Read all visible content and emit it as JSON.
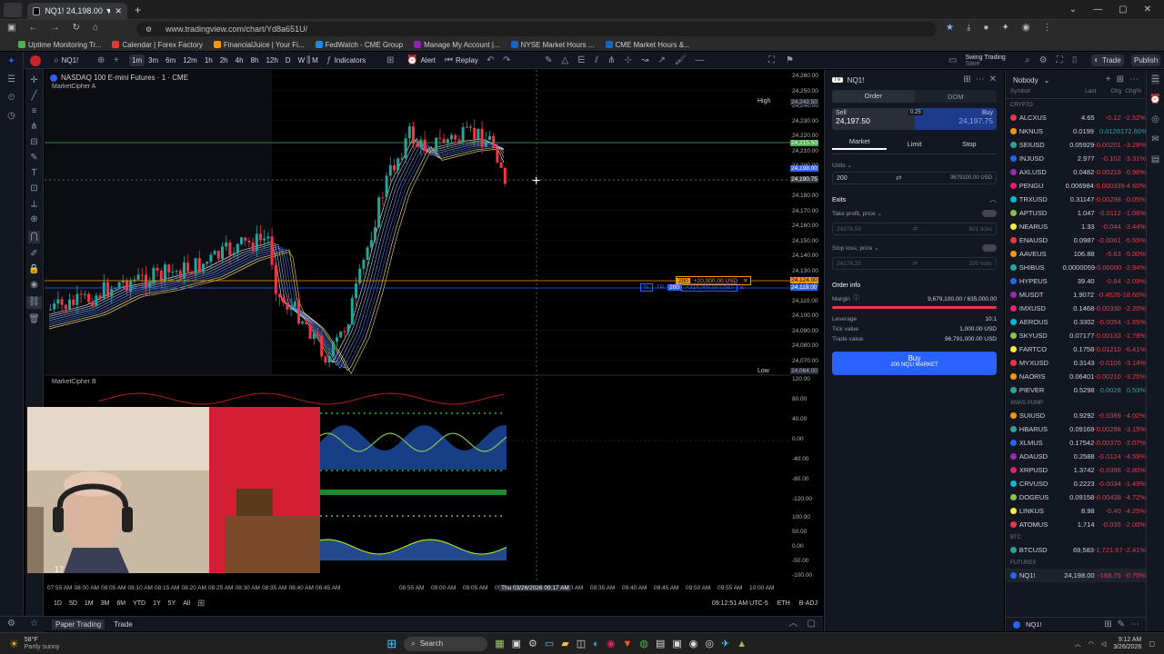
{
  "browser": {
    "tab_title": "NQ1! 24,198.00 ▼ −0.7% Swing",
    "url": "www.tradingview.com/chart/Yd8a651U/",
    "bookmarks": [
      "Uptime Monitoring Tr...",
      "Calendar | Forex Factory",
      "FinancialJuice | Your Fi...",
      "FedWatch - CME Group",
      "Manage My Account |...",
      "NYSE Market Hours ...",
      "CME Market Hours &..."
    ]
  },
  "toolbar": {
    "symbol": "NQ1!",
    "tf_active": "1m",
    "timeframes": [
      "3m",
      "6m",
      "12m",
      "1h",
      "2h",
      "4h",
      "8h",
      "12h",
      "D",
      "W",
      "M"
    ],
    "indicators": "Indicators",
    "alert": "Alert",
    "replay": "Replay",
    "layout_name": "Swing Trading",
    "layout_sub": "Save",
    "trade": "Trade",
    "publish": "Publish"
  },
  "chart": {
    "title": "NASDAQ 100 E-mini Futures · 1 · CME",
    "indicator_a": "MarketCipher A",
    "indicator_b": "MarketCipher B",
    "high_label": "High",
    "high_value": "24,242.50",
    "low_label": "Low",
    "low_value": "24,064.00",
    "price_ticks": [
      "24,260.00",
      "24,250.00",
      "24,240.00",
      "24,230.00",
      "24,220.00",
      "24,210.00",
      "24,200.00",
      "24,190.00",
      "24,180.00",
      "24,170.00",
      "24,160.00",
      "24,150.00",
      "24,140.00",
      "24,130.00",
      "24,120.00",
      "24,110.00",
      "24,100.00",
      "24,090.00",
      "24,080.00",
      "24,070.00"
    ],
    "price_tag_1": "24,215.50",
    "price_tag_2": "24,198.00",
    "price_tag_3": "24,190.75",
    "price_tag_4": "24,124.00",
    "price_tag_5": "24,119.00",
    "sl_qty": "200",
    "sl_text": "+20,000.00 USD",
    "tp_label": "TP",
    "tp_qty": "200",
    "tp_text": "+314,000.00 USD",
    "osc_ticks": [
      "120.00",
      "80.00",
      "40.00",
      "0.00",
      "-40.00",
      "-80.00",
      "-120.00"
    ],
    "osc2_ticks": [
      "100.00",
      "50.00",
      "0.00",
      "-50.00",
      "-100.00"
    ],
    "time_ticks": [
      "07:55 AM",
      "08:00 AM",
      "08:05 AM",
      "08:10 AM",
      "08:15 AM",
      "08:20 AM",
      "08:25 AM",
      "08:30 AM",
      "08:35 AM",
      "08:40 AM",
      "08:45 AM",
      "08:55 AM",
      "09:00 AM",
      "09:05 AM",
      "09:10",
      "09:25 AM",
      "09:30 AM",
      "09:35 AM",
      "09:40 AM",
      "09:45 AM",
      "09:50 AM",
      "09:55 AM",
      "10:00 AM"
    ],
    "crosshair_time": "Thu 03/26/2026",
    "crosshair_time2": "09:17 AM",
    "ranges": [
      "1D",
      "5D",
      "1M",
      "3M",
      "6M",
      "YTD",
      "1Y",
      "5Y",
      "All"
    ],
    "clock": "09:12:51 AM UTC-5",
    "session": "ETH",
    "adj": "B-ADJ"
  },
  "order": {
    "symbol": "NQ1!",
    "tab_order": "Order",
    "tab_dom": "DOM",
    "sell_label": "Sell",
    "sell_price": "24,197.50",
    "spread": "0.25",
    "buy_label": "Buy",
    "buy_price": "24,197.75",
    "types": [
      "Market",
      "Limit",
      "Stop"
    ],
    "units_label": "Units",
    "units_value": "200",
    "units_usd": "9679100.00 USD",
    "exits": "Exits",
    "tp_label": "Take profit, price",
    "tp_price": "24376.50",
    "tp_ticks": "601 ticks",
    "sl_label": "Stop loss, price",
    "sl_price": "24176.25",
    "sl_ticks": "200 ticks",
    "info": "Order info",
    "margin_label": "Margin",
    "margin_value": "9,679,100.00 / 635,000.00",
    "leverage_label": "Leverage",
    "leverage_value": "10:1",
    "tick_label": "Tick value",
    "tick_value": "1,000.00 USD",
    "trade_label": "Trade value",
    "trade_value": "96,791,000.00 USD",
    "buy_button": "Buy",
    "buy_sub": "200 NQ1! MARKET"
  },
  "watch": {
    "list_name": "Nobody",
    "col_symbol": "Symbol",
    "col_last": "Last",
    "col_chg": "Chg",
    "col_chgp": "Chg%",
    "sections": [
      {
        "name": "CRYPTO",
        "rows": [
          [
            "ALCXUS",
            "4.65",
            "-0.12",
            "-2.52%"
          ],
          [
            "NKNUS",
            "0.0199",
            "0.0126",
            "172.60%"
          ],
          [
            "SEIUSD",
            "0.05929",
            "-0.00201",
            "-3.28%"
          ],
          [
            "INJUSD",
            "2.977",
            "-0.102",
            "-3.31%"
          ],
          [
            "AXLUSD",
            "0.0482",
            "-0.00219",
            "-0.96%"
          ],
          [
            "PENGU",
            "0.006984",
            "-0.000339",
            "-4.60%"
          ],
          [
            "TRXUSD",
            "0.31147",
            "-0.00298",
            "-0.05%"
          ],
          [
            "APTUSD",
            "1.047",
            "-0.0112",
            "-1.06%"
          ],
          [
            "NEARUS",
            "1.33",
            "-0.044",
            "-3.44%"
          ],
          [
            "ENAUSD",
            "0.0987",
            "-0.0061",
            "-5.55%"
          ],
          [
            "AAVEUS",
            "106.88",
            "-5.63",
            "-5.00%"
          ],
          [
            "SHIBUS",
            "0.0000059",
            "-0.00000",
            "-2.94%"
          ],
          [
            "HYPEUS",
            "39.40",
            "-0.84",
            "-2.09%"
          ],
          [
            "MUSDT",
            "1.9072",
            "-0.4526",
            "-18.60%"
          ],
          [
            "IMXUSD",
            "0.1468",
            "-0.00330",
            "-2.20%"
          ],
          [
            "AEROUS",
            "0.3302",
            "-0.0054",
            "-1.65%"
          ],
          [
            "SKYUSD",
            "0.07177",
            "-0.00133",
            "-1.78%"
          ],
          [
            "FARTCO",
            "0.1758",
            "-0.01210",
            "-6.41%"
          ],
          [
            "MYXUSD",
            "0.3143",
            "-0.0106",
            "-3.14%"
          ],
          [
            "NAORIS",
            "0.06401",
            "-0.00210",
            "-3.25%"
          ],
          [
            "PIEVER",
            "0.5298",
            "0.0028",
            "0.53%"
          ]
        ]
      },
      {
        "name": "XMAS PUMP",
        "rows": [
          [
            "SUIUSD",
            "0.9292",
            "-0.0389",
            "-4.02%"
          ],
          [
            "HBARUS",
            "0.09169",
            "-0.00298",
            "-3.15%"
          ],
          [
            "XLMUS",
            "0.17542",
            "-0.00370",
            "-2.07%"
          ],
          [
            "ADAUSD",
            "0.2588",
            "-0.0124",
            "-4.59%"
          ],
          [
            "XRPUSD",
            "1.3742",
            "-0.0396",
            "-2.80%"
          ],
          [
            "CRVUSD",
            "0.2223",
            "-0.0034",
            "-1.49%"
          ],
          [
            "DOGEUS",
            "0.09158",
            "-0.00438",
            "-4.72%"
          ],
          [
            "LINKUS",
            "8.98",
            "-0.40",
            "-4.25%"
          ],
          [
            "ATOMUS",
            "1.714",
            "-0.035",
            "-2.00%"
          ]
        ]
      },
      {
        "name": "BTC",
        "rows": [
          [
            "BTCUSD",
            "69,583",
            "-1,721.57",
            "-2.41%"
          ]
        ]
      },
      {
        "name": "FUTURES",
        "rows": [
          [
            "NQ1!",
            "24,198.00",
            "-169.75",
            "-0.70%"
          ]
        ]
      }
    ],
    "footer_symbol": "NQ1!"
  },
  "bottom": {
    "paper": "Paper Trading",
    "trade": "Trade"
  },
  "taskbar": {
    "temp": "58°F",
    "weather": "Partly sunny",
    "search": "Search",
    "time": "9:12 AM",
    "date": "3/26/2026"
  },
  "colors": {
    "bg": "#000000",
    "up": "#26a69a",
    "down": "#f23645",
    "accent": "#2962ff"
  }
}
